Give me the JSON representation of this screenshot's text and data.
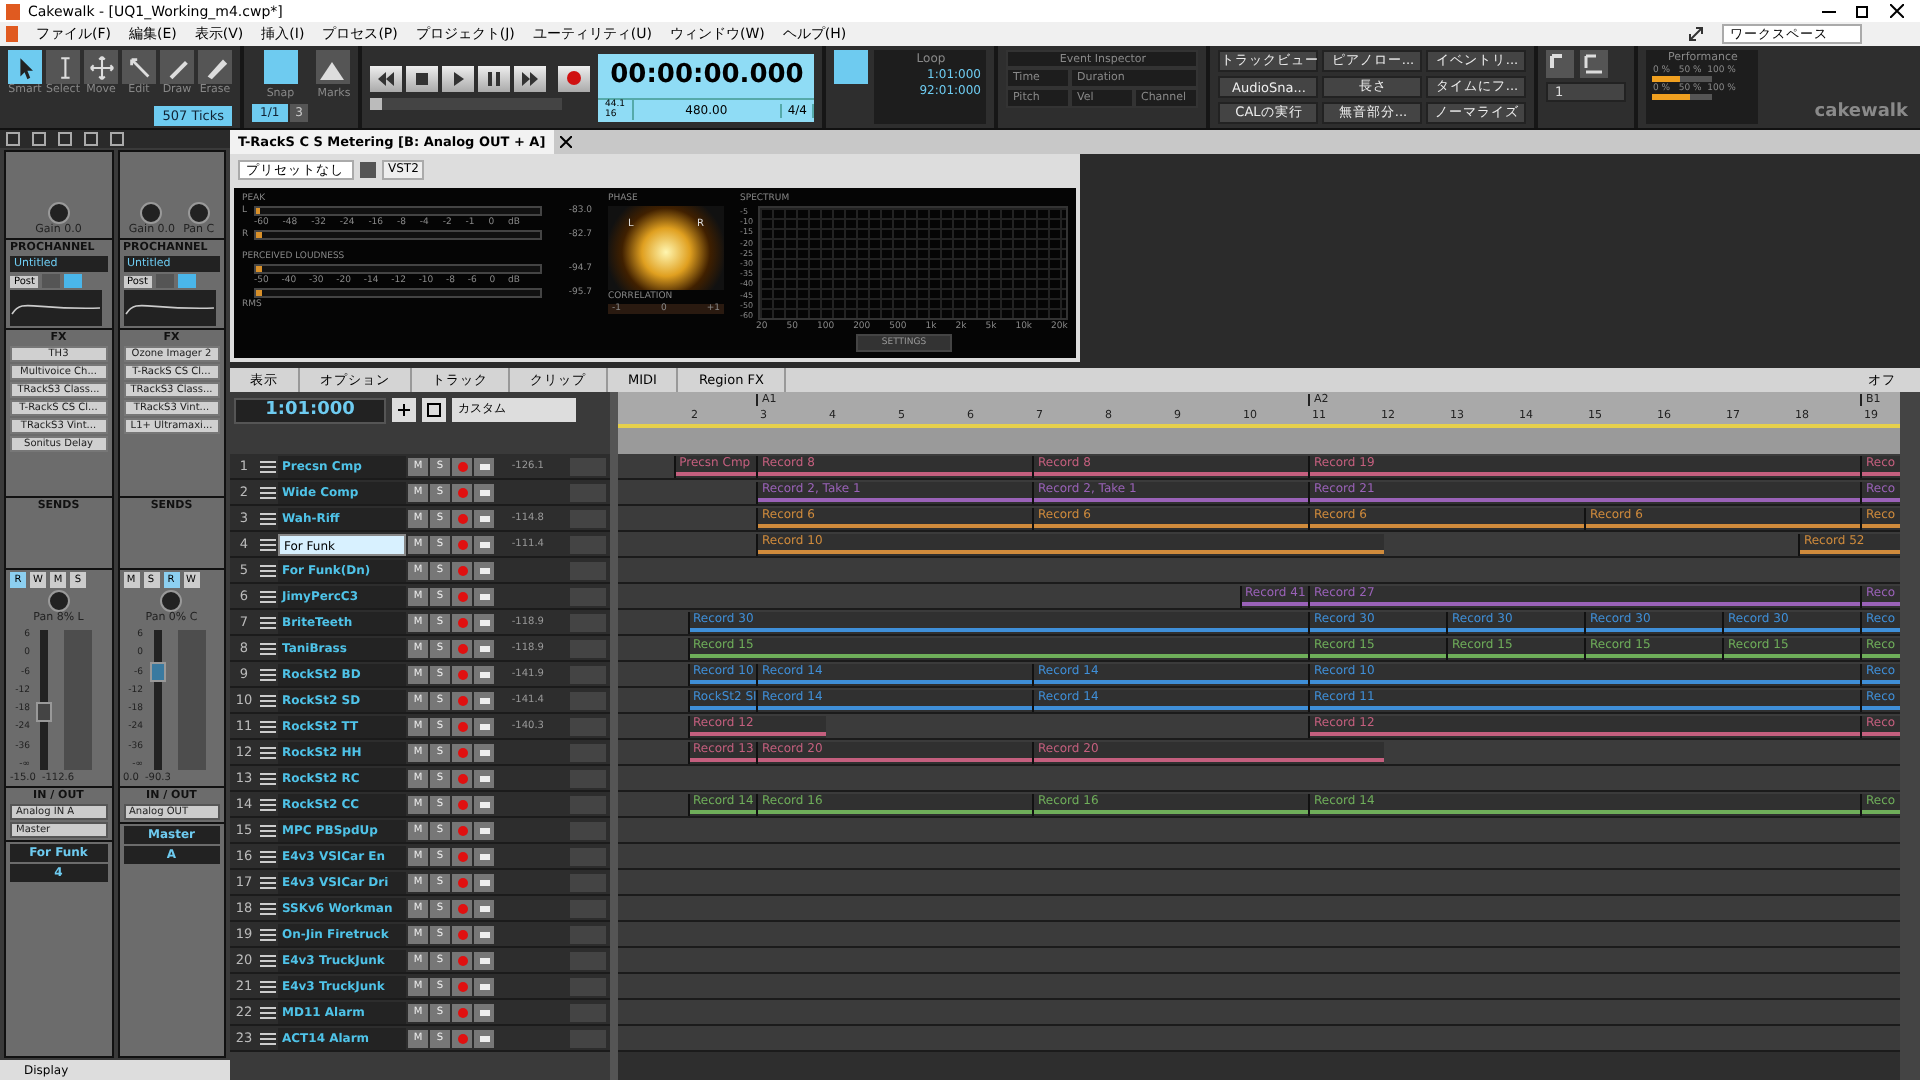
{
  "window": {
    "title": "Cakewalk - [UQ1_Working_m4.cwp*]"
  },
  "menu": [
    "ファイル(F)",
    "編集(E)",
    "表示(V)",
    "挿入(I)",
    "プロセス(P)",
    "プロジェクト(J)",
    "ユーティリティ(U)",
    "ウィンドウ(W)",
    "ヘルプ(H)"
  ],
  "workspace": "ワークスペース",
  "tools": [
    {
      "label": "Smart",
      "selected": true
    },
    {
      "label": "Select",
      "selected": false
    },
    {
      "label": "Move",
      "selected": false
    },
    {
      "label": "Edit",
      "selected": false
    },
    {
      "label": "Draw",
      "selected": false
    },
    {
      "label": "Erase",
      "selected": false
    }
  ],
  "ticks": "507 Ticks",
  "snap": {
    "label": "Snap",
    "on": true,
    "value": "1/1",
    "count": "3",
    "marks": "Marks"
  },
  "transport": {
    "position": {
      "level": 0
    },
    "time": "00:00:00.000",
    "sample_rate": "44.1",
    "bit_depth": "16",
    "tempo": "480.00",
    "meter": "4/4"
  },
  "loop": {
    "label": "Loop",
    "on": true,
    "start": "1:01:000",
    "end": "92:01:000"
  },
  "event_inspector": {
    "title": "Event Inspector",
    "fields": [
      "Time",
      "Duration",
      "Pitch",
      "Vel",
      "Channel"
    ]
  },
  "quick_buttons": [
    "トラックビュー",
    "ピアノロー...",
    "イベントリ...",
    "AudioSna...",
    "長さ",
    "タイムにフ...",
    "CALの実行",
    "無音部分...",
    "ノーマライズ"
  ],
  "view_dropdown": "1",
  "performance": {
    "title": "Performance",
    "meters": [
      {
        "level": 0.45,
        "scale": "0 %   50 %  100 %"
      },
      {
        "level": 0.62,
        "scale": "0 %   50 %  100 %"
      }
    ]
  },
  "brand": "cakewalk",
  "inspector": {
    "strips": [
      {
        "knobs": [
          "Gain 0.0"
        ],
        "prochannel": "PROCHANNEL",
        "preset": "Untitled",
        "post": "Post",
        "power": true,
        "fx_title": "FX",
        "fx": [
          "TH3",
          "Multivoice Ch...",
          "TRackS3 Class...",
          "T-RackS CS Cl...",
          "TRackS3 Vint...",
          "Sonitus Delay"
        ],
        "sends": "SENDS",
        "buttons": [
          {
            "label": "R",
            "on": true
          },
          {
            "label": "W",
            "on": false
          },
          {
            "label": "M",
            "on": false
          },
          {
            "label": "S",
            "on": false
          }
        ],
        "pan": "Pan 8% L",
        "scale": [
          "6",
          "0",
          "-6",
          "-12",
          "-18",
          "-24",
          "-36",
          "-∞"
        ],
        "level": 0.42,
        "readings": [
          "-15.0",
          "-112.6"
        ],
        "io_title": "IN / OUT",
        "io": [
          "Analog IN A",
          "Master"
        ],
        "name": "For Funk",
        "number": "4"
      },
      {
        "knobs": [
          "Gain 0.0",
          "Pan  C"
        ],
        "prochannel": "PROCHANNEL",
        "preset": "Untitled",
        "post": "Post",
        "power": true,
        "fx_title": "FX",
        "fx": [
          "Ozone Imager 2",
          "T-RackS CS Cl...",
          "TRackS3 Class...",
          "TRackS3 Vint...",
          "L1+ Ultramaxi..."
        ],
        "sends": "SENDS",
        "buttons": [
          {
            "label": "M",
            "on": false
          },
          {
            "label": "S",
            "on": false
          },
          {
            "label": "R",
            "on": true
          },
          {
            "label": "W",
            "on": false
          }
        ],
        "pan": "Pan 0% C",
        "scale": [
          "6",
          "0",
          "-6",
          "-12",
          "-18",
          "-24",
          "-36",
          "-∞"
        ],
        "level": 0.74,
        "readings": [
          "0.0",
          "-90.3"
        ],
        "io_title": "IN / OUT",
        "io": [
          "Analog OUT"
        ],
        "name": "Master",
        "number": "A"
      }
    ],
    "display": "Display"
  },
  "plugin": {
    "tab": "T-RackS C S Metering [B: Analog OUT + A]",
    "preset": "プリセットなし",
    "format": "VST2",
    "peak": {
      "title": "PEAK",
      "channels": [
        {
          "label": "L",
          "level": 0.02,
          "reading": "-83.0"
        },
        {
          "label": "R",
          "level": 0.02,
          "reading": "-82.7"
        }
      ],
      "scale": [
        "-60",
        "-48",
        "-32",
        "-24",
        "-16",
        "-8",
        "-4",
        "-2",
        "-1",
        "0"
      ],
      "unit": "dB"
    },
    "loudness": {
      "title": "PERCEIVED LOUDNESS",
      "channels": [
        {
          "level": 0.02,
          "reading": "-94.7"
        },
        {
          "level": 0.02,
          "reading": "-95.7"
        }
      ],
      "scale": [
        "-50",
        "-40",
        "-30",
        "-20",
        "-14",
        "-12",
        "-10",
        "-8",
        "-6",
        "0"
      ],
      "unit": "dB",
      "footer": "RMS"
    },
    "phase": {
      "title": "PHASE",
      "left": "L",
      "right": "R",
      "correlation": "CORRELATION",
      "corr_scale": [
        "-1",
        "0",
        "+1"
      ]
    },
    "spectrum": {
      "title": "SPECTRUM",
      "yticks": [
        "-5",
        "-10",
        "-15",
        "-20",
        "-25",
        "-30",
        "-35",
        "-40",
        "-45",
        "-50",
        "-60"
      ],
      "xticks": [
        "20",
        "50",
        "100",
        "200",
        "500",
        "1k",
        "2k",
        "5k",
        "10k",
        "20k"
      ],
      "settings": "SETTINGS"
    }
  },
  "track_view": {
    "menus": [
      "表示",
      "オプション",
      "トラック",
      "クリップ",
      "MIDI",
      "Region FX"
    ],
    "snap_off": "オフ",
    "now": "1:01:000",
    "preset": "カスタム",
    "markers": [
      "A1",
      "A2",
      "B1"
    ],
    "bars": [
      "2",
      "3",
      "4",
      "5",
      "6",
      "7",
      "8",
      "9",
      "10",
      "11",
      "12",
      "13",
      "14",
      "15",
      "16",
      "17",
      "18",
      "19"
    ],
    "tracks": [
      {
        "number": "1",
        "name": "Precsn Cmp",
        "mute": "M",
        "solo": "S",
        "reading": "-126.1",
        "selected": false,
        "color": "#c45f7e",
        "clips": [
          "Precsn Cmp",
          "Record 8",
          "Record 8",
          "Record 19",
          "Reco"
        ]
      },
      {
        "number": "2",
        "name": "Wide Comp",
        "mute": "M",
        "solo": "S",
        "selected": false,
        "color": "#9a62b8",
        "clips": [
          "Record 2, Take 1",
          "Record 2, Take 1",
          "Record 21",
          "Reco"
        ]
      },
      {
        "number": "3",
        "name": "Wah-Riff",
        "mute": "M",
        "solo": "S",
        "reading": "-114.8",
        "selected": false,
        "color": "#d08b3c",
        "clips": [
          "Record 6",
          "Record 6",
          "Record 6",
          "Record 6",
          "Reco"
        ]
      },
      {
        "number": "4",
        "name": "For Funk",
        "mute": "M",
        "solo": "S",
        "reading": "-111.4",
        "selected": true,
        "color": "#d08b3c",
        "clips": [
          "Record 10",
          "Record 52"
        ]
      },
      {
        "number": "5",
        "name": "For Funk(Dn)",
        "mute": "M",
        "solo": "S",
        "selected": false
      },
      {
        "number": "6",
        "name": "JimyPercC3",
        "mute": "M",
        "solo": "S",
        "selected": false,
        "color": "#9a62b8",
        "clips": [
          "Record 41",
          "Record 27",
          "Reco"
        ]
      },
      {
        "number": "7",
        "name": "BriteTeeth",
        "mute": "M",
        "solo": "S",
        "reading": "-118.9",
        "selected": false,
        "color": "#3f8fd8",
        "clips": [
          "Record 30",
          "Record 30",
          "Record 30",
          "Record 30",
          "Record 30",
          "Reco"
        ]
      },
      {
        "number": "8",
        "name": "TaniBrass",
        "mute": "M",
        "solo": "S",
        "reading": "-118.9",
        "selected": false,
        "color": "#6fae5a",
        "clips": [
          "Record 15",
          "Record 15",
          "Record 15",
          "Record 15",
          "Record 15",
          "Reco"
        ]
      },
      {
        "number": "9",
        "name": "RockSt2 BD",
        "mute": "M",
        "solo": "S",
        "reading": "-141.9",
        "selected": false,
        "color": "#3f8fd8",
        "clips": [
          "Record 10",
          "Record 14",
          "Record 14",
          "Record 10",
          "Reco"
        ]
      },
      {
        "number": "10",
        "name": "RockSt2 SD",
        "mute": "M",
        "solo": "S",
        "reading": "-141.4",
        "selected": false,
        "color": "#3f8fd8",
        "clips": [
          "RockSt2 SI",
          "Record 14",
          "Record 14",
          "Record 11",
          "Reco"
        ]
      },
      {
        "number": "11",
        "name": "RockSt2 TT",
        "mute": "M",
        "solo": "S",
        "reading": "-140.3",
        "selected": false,
        "color": "#c45f7e",
        "clips": [
          "Record 12",
          "Record 12",
          "Reco"
        ]
      },
      {
        "number": "12",
        "name": "RockSt2 HH",
        "mute": "M",
        "solo": "S",
        "selected": false,
        "color": "#c45f7e",
        "clips": [
          "Record 13",
          "Record 20",
          "Record 20"
        ]
      },
      {
        "number": "13",
        "name": "RockSt2 RC",
        "mute": "M",
        "solo": "S",
        "selected": false
      },
      {
        "number": "14",
        "name": "RockSt2 CC",
        "mute": "M",
        "solo": "S",
        "selected": false,
        "color": "#6fae5a",
        "clips": [
          "Record 14",
          "Record 16",
          "Record 16",
          "Record 14",
          "Reco"
        ]
      },
      {
        "number": "15",
        "name": "MPC PBSpdUp",
        "mute": "M",
        "solo": "S",
        "selected": false
      },
      {
        "number": "16",
        "name": "E4v3 VSICar En",
        "mute": "M",
        "solo": "S",
        "selected": false
      },
      {
        "number": "17",
        "name": "E4v3 VSICar Dri",
        "mute": "M",
        "solo": "S",
        "selected": false
      },
      {
        "number": "18",
        "name": "SSKv6 Workman",
        "mute": "M",
        "solo": "S",
        "selected": false
      },
      {
        "number": "19",
        "name": "On-Jin Firetruck",
        "mute": "M",
        "solo": "S",
        "selected": false
      },
      {
        "number": "20",
        "name": "E4v3 TruckJunk",
        "mute": "M",
        "solo": "S",
        "selected": false
      },
      {
        "number": "21",
        "name": "E4v3 TruckJunk",
        "mute": "M",
        "solo": "S",
        "selected": false
      },
      {
        "number": "22",
        "name": "MD11 Alarm",
        "mute": "M",
        "solo": "S",
        "selected": false
      },
      {
        "number": "23",
        "name": "ACT14 Alarm",
        "mute": "M",
        "solo": "S",
        "selected": false
      }
    ]
  }
}
